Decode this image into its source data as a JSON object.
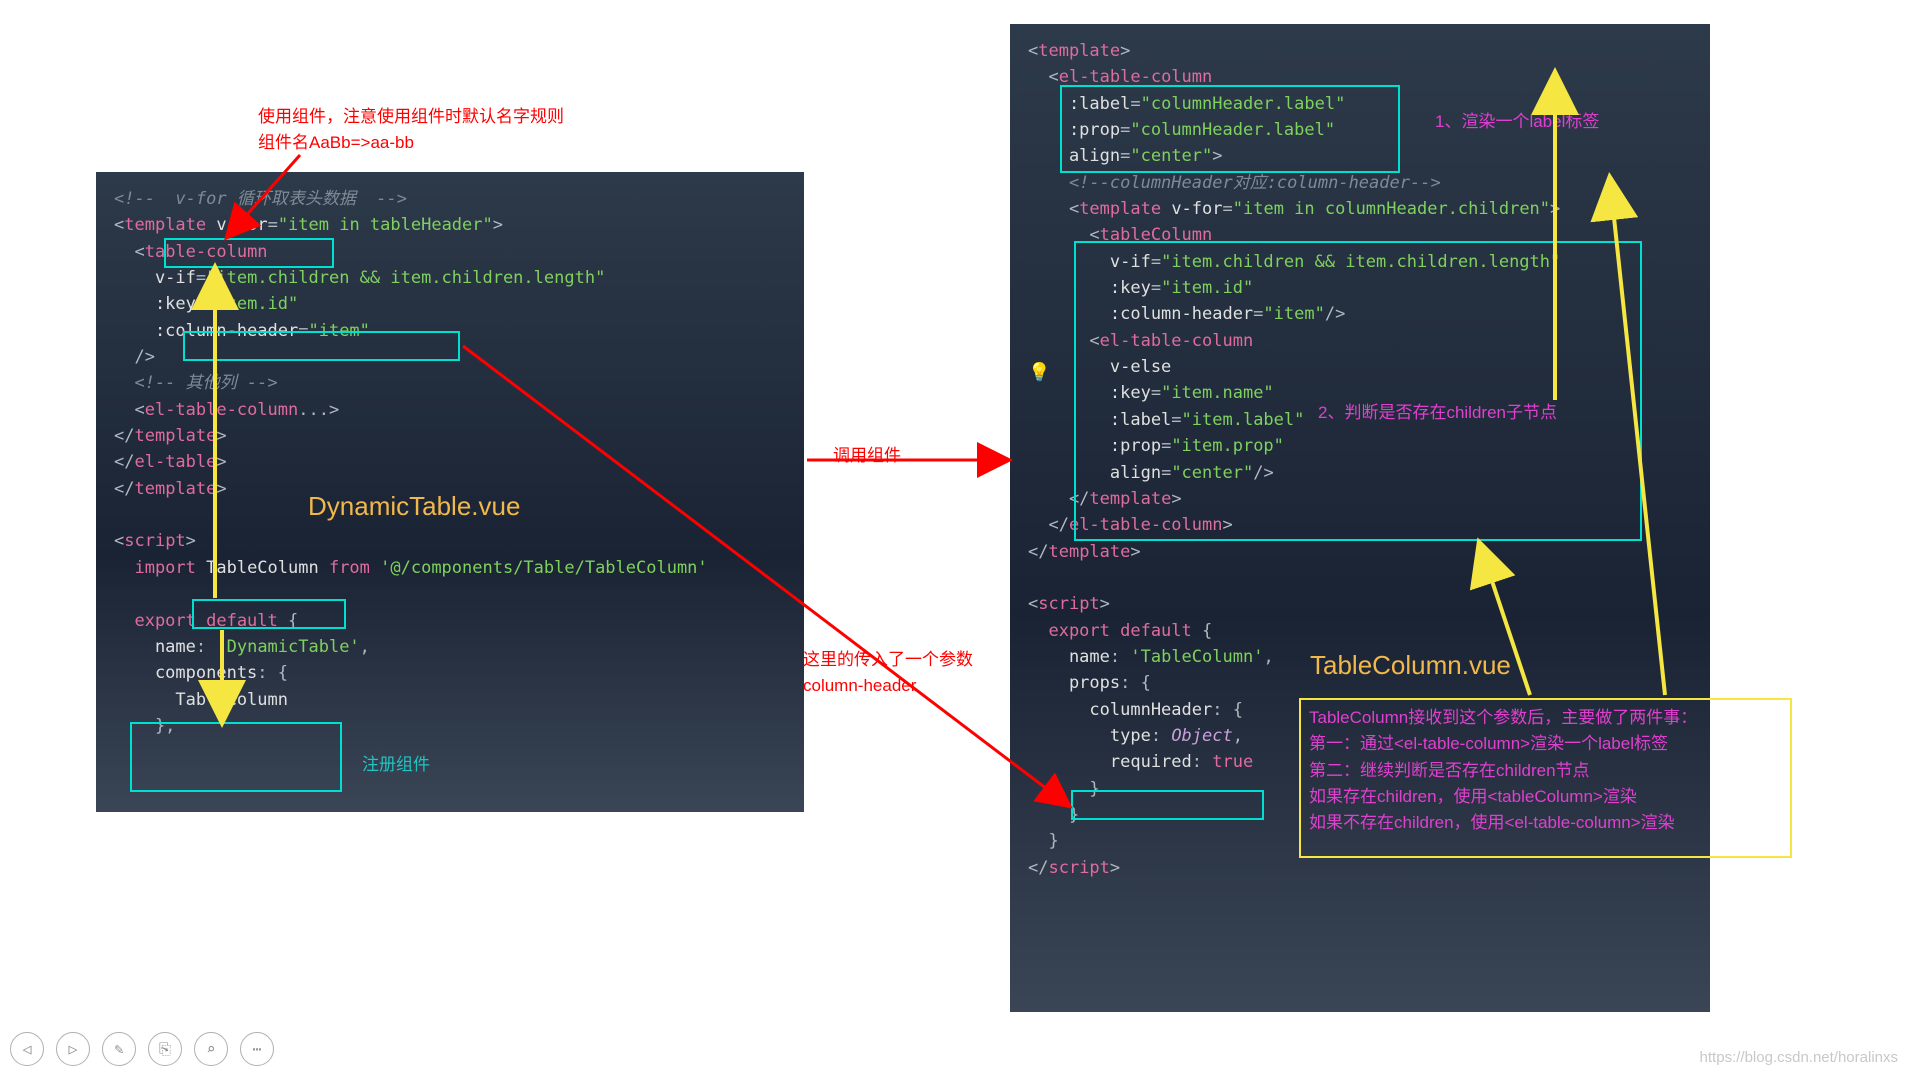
{
  "left_panel": {
    "title": "DynamicTable.vue",
    "lines": [
      {
        "raw": "<!-- v-for 循环取表头数据 -->",
        "parts": [
          [
            "comment",
            "<!--  v-for 循环取表头数据  -->"
          ]
        ]
      },
      {
        "parts": [
          [
            "punct",
            "<"
          ],
          [
            "tag",
            "template "
          ],
          [
            "attr",
            "v-for"
          ],
          [
            "punct",
            "="
          ],
          [
            "str",
            "\"item in tableHeader\""
          ],
          [
            "punct",
            ">"
          ]
        ]
      },
      {
        "parts": [
          [
            "punct",
            "  <"
          ],
          [
            "tag",
            "table-column"
          ]
        ]
      },
      {
        "parts": [
          [
            "attr",
            "    v-if"
          ],
          [
            "punct",
            "="
          ],
          [
            "str",
            "\"item.children && item.children.length\""
          ]
        ]
      },
      {
        "parts": [
          [
            "attr",
            "    :key"
          ],
          [
            "punct",
            "="
          ],
          [
            "str",
            "\"item.id\""
          ]
        ]
      },
      {
        "parts": [
          [
            "attr",
            "    :column-header"
          ],
          [
            "punct",
            "="
          ],
          [
            "str",
            "\"item\""
          ]
        ]
      },
      {
        "parts": [
          [
            "punct",
            "  />"
          ]
        ]
      },
      {
        "parts": [
          [
            "comment",
            "  <!-- 其他列 -->"
          ]
        ]
      },
      {
        "parts": [
          [
            "punct",
            "  <"
          ],
          [
            "tag",
            "el-table-column"
          ],
          [
            "punct",
            "..."
          ],
          [
            "punct",
            ">"
          ]
        ]
      },
      {
        "parts": [
          [
            "punct",
            "</"
          ],
          [
            "tag",
            "template"
          ],
          [
            "punct",
            ">"
          ]
        ]
      },
      {
        "parts": [
          [
            "punct",
            "</"
          ],
          [
            "tag",
            "el-table"
          ],
          [
            "punct",
            ">"
          ]
        ]
      },
      {
        "parts": [
          [
            "punct",
            "</"
          ],
          [
            "tag",
            "template"
          ],
          [
            "punct",
            ">"
          ]
        ]
      },
      {
        "parts": [
          [
            "name",
            " "
          ]
        ]
      },
      {
        "parts": [
          [
            "punct",
            "<"
          ],
          [
            "tag",
            "script"
          ],
          [
            "punct",
            ">"
          ]
        ]
      },
      {
        "parts": [
          [
            "kw",
            "  import "
          ],
          [
            "name",
            "TableColumn"
          ],
          [
            "kw",
            " from "
          ],
          [
            "str",
            "'@/components/Table/TableColumn'"
          ]
        ]
      },
      {
        "parts": [
          [
            "name",
            " "
          ]
        ]
      },
      {
        "parts": [
          [
            "kw",
            "  export default "
          ],
          [
            "punct",
            "{"
          ]
        ]
      },
      {
        "parts": [
          [
            "key",
            "    name"
          ],
          [
            "punct",
            ": "
          ],
          [
            "str",
            "'DynamicTable'"
          ],
          [
            "punct",
            ","
          ]
        ]
      },
      {
        "parts": [
          [
            "key",
            "    components"
          ],
          [
            "punct",
            ": {"
          ]
        ]
      },
      {
        "parts": [
          [
            "name",
            "      TableColumn"
          ]
        ]
      },
      {
        "parts": [
          [
            "punct",
            "    },"
          ]
        ]
      }
    ]
  },
  "right_panel": {
    "title": "TableColumn.vue",
    "lines": [
      {
        "parts": [
          [
            "punct",
            "<"
          ],
          [
            "tag",
            "template"
          ],
          [
            "punct",
            ">"
          ]
        ]
      },
      {
        "parts": [
          [
            "punct",
            "  <"
          ],
          [
            "tag",
            "el-table-column"
          ]
        ]
      },
      {
        "parts": [
          [
            "attr",
            "    :label"
          ],
          [
            "punct",
            "="
          ],
          [
            "str",
            "\"columnHeader.label\""
          ]
        ]
      },
      {
        "parts": [
          [
            "attr",
            "    :prop"
          ],
          [
            "punct",
            "="
          ],
          [
            "str",
            "\"columnHeader.label\""
          ]
        ]
      },
      {
        "parts": [
          [
            "attr",
            "    align"
          ],
          [
            "punct",
            "="
          ],
          [
            "str",
            "\"center\""
          ],
          [
            "punct",
            ">"
          ]
        ]
      },
      {
        "parts": [
          [
            "comment",
            "    <!--columnHeader对应:column-header-->"
          ]
        ]
      },
      {
        "parts": [
          [
            "punct",
            "    <"
          ],
          [
            "tag",
            "template "
          ],
          [
            "attr",
            "v-for"
          ],
          [
            "punct",
            "="
          ],
          [
            "str",
            "\"item in columnHeader.children\""
          ],
          [
            "punct",
            ">"
          ]
        ]
      },
      {
        "parts": [
          [
            "punct",
            "      <"
          ],
          [
            "tag",
            "tableColumn"
          ]
        ]
      },
      {
        "parts": [
          [
            "attr",
            "        v-if"
          ],
          [
            "punct",
            "="
          ],
          [
            "str",
            "\"item.children && item.children.length\""
          ]
        ]
      },
      {
        "parts": [
          [
            "attr",
            "        :key"
          ],
          [
            "punct",
            "="
          ],
          [
            "str",
            "\"item.id\""
          ]
        ]
      },
      {
        "parts": [
          [
            "attr",
            "        :column-header"
          ],
          [
            "punct",
            "="
          ],
          [
            "str",
            "\"item\""
          ],
          [
            "punct",
            "/>"
          ]
        ]
      },
      {
        "parts": [
          [
            "punct",
            "      <"
          ],
          [
            "tag",
            "el-table-column"
          ]
        ]
      },
      {
        "parts": [
          [
            "attr",
            "        v-else"
          ]
        ]
      },
      {
        "parts": [
          [
            "attr",
            "        :key"
          ],
          [
            "punct",
            "="
          ],
          [
            "str",
            "\"item.name\""
          ]
        ]
      },
      {
        "parts": [
          [
            "attr",
            "        :label"
          ],
          [
            "punct",
            "="
          ],
          [
            "str",
            "\"item.label\""
          ]
        ]
      },
      {
        "parts": [
          [
            "attr",
            "        :prop"
          ],
          [
            "punct",
            "="
          ],
          [
            "str",
            "\"item.prop\""
          ]
        ]
      },
      {
        "parts": [
          [
            "attr",
            "        align"
          ],
          [
            "punct",
            "="
          ],
          [
            "str",
            "\"center\""
          ],
          [
            "punct",
            "/>"
          ]
        ]
      },
      {
        "parts": [
          [
            "punct",
            "    </"
          ],
          [
            "tag",
            "template"
          ],
          [
            "punct",
            ">"
          ]
        ]
      },
      {
        "parts": [
          [
            "punct",
            "  </"
          ],
          [
            "tag",
            "el-table-column"
          ],
          [
            "punct",
            ">"
          ]
        ]
      },
      {
        "parts": [
          [
            "punct",
            "</"
          ],
          [
            "tag",
            "template"
          ],
          [
            "punct",
            ">"
          ]
        ]
      },
      {
        "parts": [
          [
            "name",
            " "
          ]
        ]
      },
      {
        "parts": [
          [
            "punct",
            "<"
          ],
          [
            "tag",
            "script"
          ],
          [
            "punct",
            ">"
          ]
        ]
      },
      {
        "parts": [
          [
            "kw",
            "  export default "
          ],
          [
            "punct",
            "{"
          ]
        ]
      },
      {
        "parts": [
          [
            "key",
            "    name"
          ],
          [
            "punct",
            ": "
          ],
          [
            "str",
            "'TableColumn'"
          ],
          [
            "punct",
            ","
          ]
        ]
      },
      {
        "parts": [
          [
            "key",
            "    props"
          ],
          [
            "punct",
            ": {"
          ]
        ]
      },
      {
        "parts": [
          [
            "key",
            "      columnHeader"
          ],
          [
            "punct",
            ": {"
          ]
        ]
      },
      {
        "parts": [
          [
            "key",
            "        type"
          ],
          [
            "punct",
            ": "
          ],
          [
            "type",
            "Object"
          ],
          [
            "punct",
            ","
          ]
        ]
      },
      {
        "parts": [
          [
            "key",
            "        required"
          ],
          [
            "punct",
            ": "
          ],
          [
            "bool",
            "true"
          ]
        ]
      },
      {
        "parts": [
          [
            "punct",
            "      }"
          ]
        ]
      },
      {
        "parts": [
          [
            "punct",
            "    }"
          ]
        ]
      },
      {
        "parts": [
          [
            "punct",
            "  }"
          ]
        ]
      },
      {
        "parts": [
          [
            "punct",
            "</"
          ],
          [
            "tag",
            "script"
          ],
          [
            "punct",
            ">"
          ]
        ]
      }
    ]
  },
  "annotations": {
    "top_note_l1": "使用组件，注意使用组件时默认名字规则",
    "top_note_l2": "组件名AaBb=>aa-bb",
    "call_component": "调用组件",
    "param_note_l1": "这里的传入了一个参数",
    "param_note_l2": "column-header",
    "register_component": "注册组件",
    "render_label": "1、渲染一个label标签",
    "children_note": "2、判断是否存在children子节点",
    "yellow_box_l1": "TableColumn接收到这个参数后，主要做了两件事：",
    "yellow_box_l2": "第一：通过<el-table-column>渲染一个label标签",
    "yellow_box_l3": "第二：继续判断是否存在children节点",
    "yellow_box_l4": "如果存在children，使用<tableColumn>渲染",
    "yellow_box_l5": "如果不存在children，使用<el-table-column>渲染"
  },
  "watermark": "https://blog.csdn.net/horalinxs",
  "icons": {
    "prev": "◁",
    "next": "▷",
    "pen": "✎",
    "copy": "⎘",
    "search": "⌕",
    "more": "⋯"
  }
}
